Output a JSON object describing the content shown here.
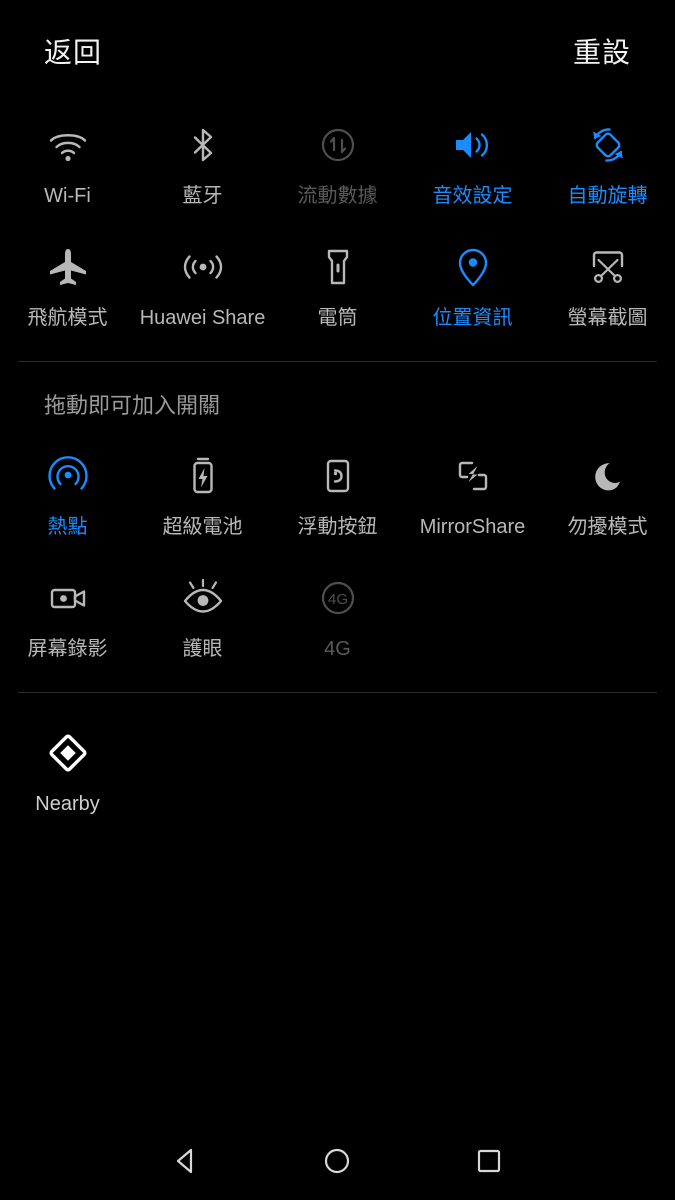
{
  "header": {
    "back_label": "返回",
    "reset_label": "重設"
  },
  "colors": {
    "background": "#000000",
    "accent_active": "#1a8cff",
    "label_inactive": "#b8b8b8",
    "label_disabled": "#5a5a5a",
    "label_nearby": "#cfcfcf",
    "divider": "#2b2b2b"
  },
  "active_section": {
    "tiles": [
      {
        "label": "Wi-Fi",
        "icon": "wifi-icon",
        "state": "off"
      },
      {
        "label": "藍牙",
        "icon": "bluetooth-icon",
        "state": "off"
      },
      {
        "label": "流動數據",
        "icon": "mobile-data-icon",
        "state": "dim"
      },
      {
        "label": "音效設定",
        "icon": "sound-icon",
        "state": "on"
      },
      {
        "label": "自動旋轉",
        "icon": "auto-rotate-icon",
        "state": "on"
      },
      {
        "label": "飛航模式",
        "icon": "airplane-icon",
        "state": "off"
      },
      {
        "label": "Huawei Share",
        "icon": "huawei-share-icon",
        "state": "off"
      },
      {
        "label": "電筒",
        "icon": "flashlight-icon",
        "state": "off"
      },
      {
        "label": "位置資訊",
        "icon": "location-pin-icon",
        "state": "on"
      },
      {
        "label": "螢幕截圖",
        "icon": "screenshot-icon",
        "state": "off"
      }
    ]
  },
  "drag_hint": "拖動即可加入開關",
  "available_section": {
    "tiles": [
      {
        "label": "熱點",
        "icon": "hotspot-icon",
        "state": "on"
      },
      {
        "label": "超級電池",
        "icon": "super-battery-icon",
        "state": "off"
      },
      {
        "label": "浮動按鈕",
        "icon": "floating-button-icon",
        "state": "off"
      },
      {
        "label": "MirrorShare",
        "icon": "mirror-share-icon",
        "state": "off"
      },
      {
        "label": "勿擾模式",
        "icon": "do-not-disturb-icon",
        "state": "off"
      },
      {
        "label": "屏幕錄影",
        "icon": "screen-record-icon",
        "state": "off"
      },
      {
        "label": "護眼",
        "icon": "eye-comfort-icon",
        "state": "off"
      },
      {
        "label": "4G",
        "icon": "four-g-icon",
        "state": "dim"
      }
    ]
  },
  "nearby_section": {
    "tiles": [
      {
        "label": "Nearby",
        "icon": "nearby-diamond-icon",
        "state": "white"
      }
    ]
  },
  "navbar": {
    "back": "back-triangle-icon",
    "home": "home-circle-icon",
    "recents": "recents-square-icon"
  }
}
